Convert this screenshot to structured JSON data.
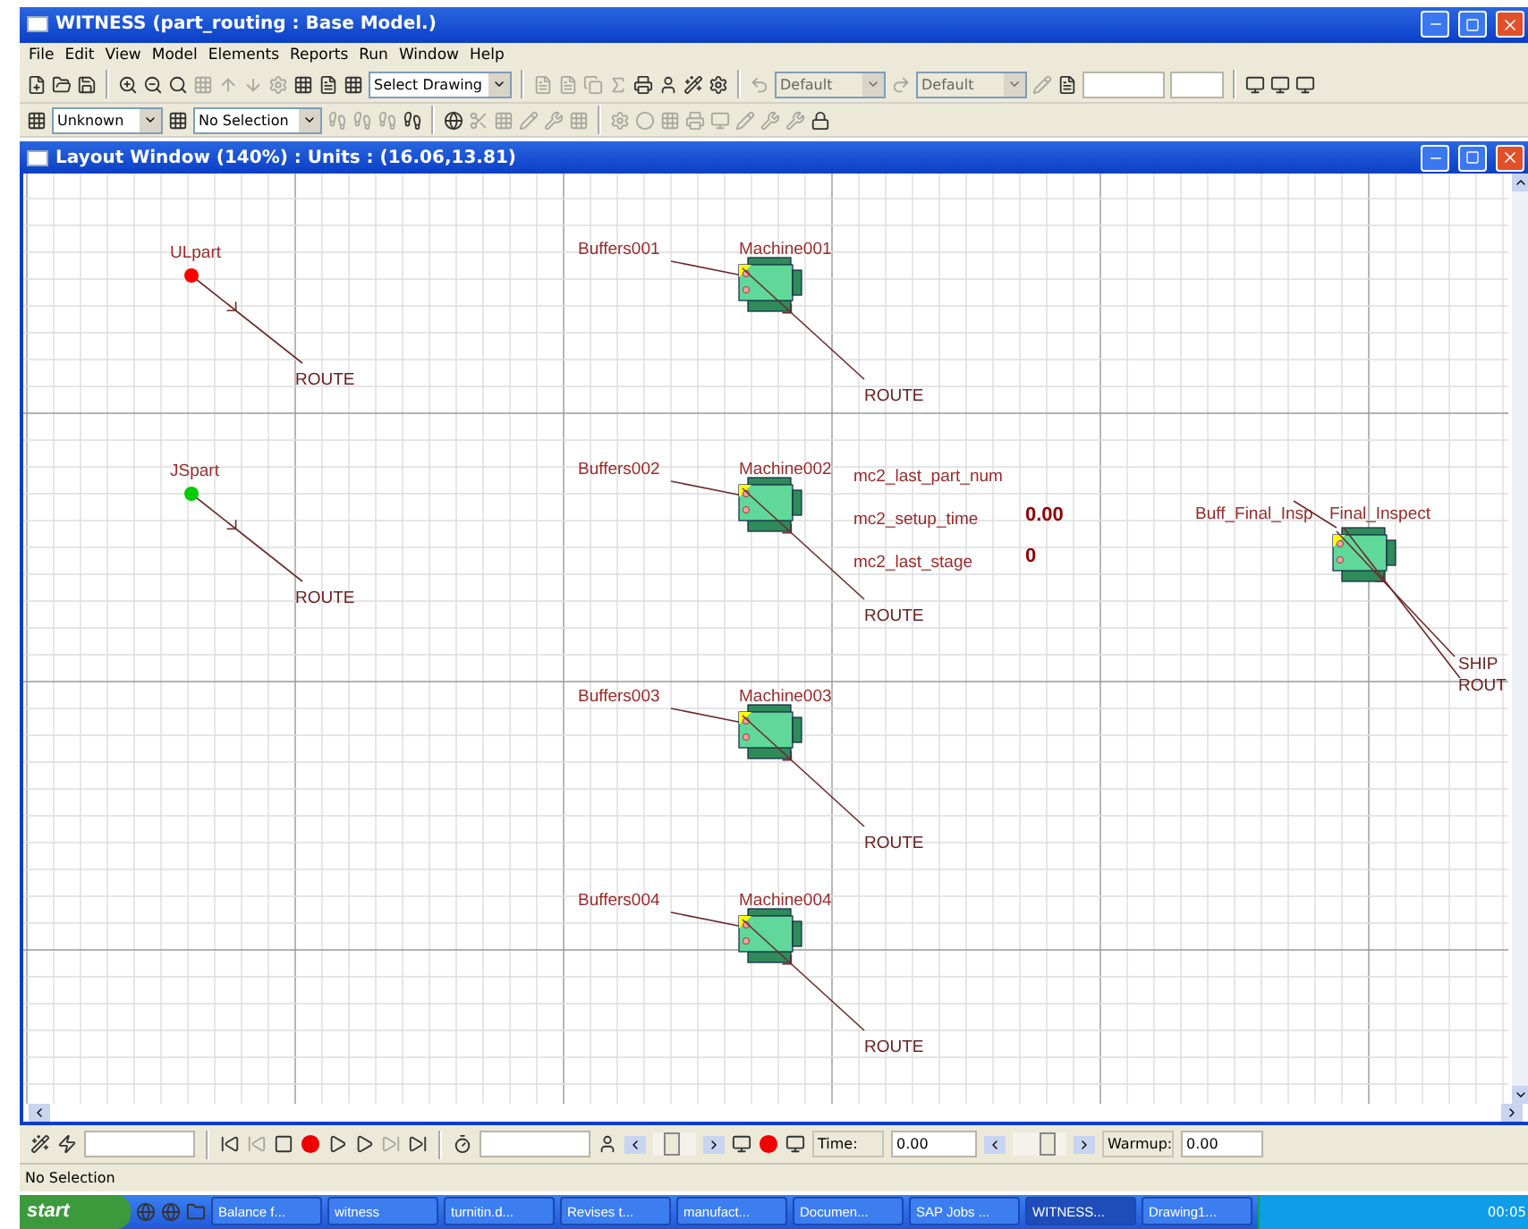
{
  "window": {
    "title": "WITNESS (part_routing : Base Model.)"
  },
  "menu": [
    "File",
    "Edit",
    "View",
    "Model",
    "Elements",
    "Reports",
    "Run",
    "Window",
    "Help"
  ],
  "toolbar": {
    "drawing_select": "Select Drawing",
    "style_selects": [
      {
        "value": "Default",
        "disabled": true
      },
      {
        "value": "Default",
        "disabled": true
      }
    ]
  },
  "element_bar": {
    "type_select": "Unknown",
    "selection_select": "No Selection"
  },
  "layout_window": {
    "title": "Layout Window (140%)  : Units : (16.06,13.81)",
    "parts": [
      {
        "name": "ULpart",
        "color": "#ff0000",
        "route": "ROUTE"
      },
      {
        "name": "JSpart",
        "color": "#00cc00",
        "route": "ROUTE"
      }
    ],
    "lines": [
      {
        "buffer": "Buffers001",
        "machine": "Machine001",
        "route": "ROUTE"
      },
      {
        "buffer": "Buffers002",
        "machine": "Machine002",
        "route": "ROUTE"
      },
      {
        "buffer": "Buffers003",
        "machine": "Machine003",
        "route": "ROUTE"
      },
      {
        "buffer": "Buffers004",
        "machine": "Machine004",
        "route": "ROUTE"
      }
    ],
    "variables": [
      {
        "name": "mc2_last_part_num"
      },
      {
        "name": "mc2_setup_time",
        "value": "0.00"
      },
      {
        "name": "mc2_last_stage",
        "value": "0"
      }
    ],
    "final": {
      "buffer": "Buff_Final_Insp",
      "machine": "Final_Inspect",
      "routes": [
        "SHIP",
        "ROUT"
      ]
    }
  },
  "run_bar": {
    "speed_slider": {
      "level": 0.4
    },
    "time_slider": {
      "level": 0.7
    },
    "time_label": "Time:",
    "time": "0.00",
    "warmup_label": "Warmup:",
    "warmup": "0.00"
  },
  "status_bar": "No Selection",
  "taskbar": {
    "start": "start",
    "tasks": [
      {
        "label": "Balance f...",
        "selected": false
      },
      {
        "label": "witness",
        "selected": false
      },
      {
        "label": "turnitin.d...",
        "selected": false
      },
      {
        "label": "Revises t...",
        "selected": false
      },
      {
        "label": "manufact...",
        "selected": false
      },
      {
        "label": "Documen...",
        "selected": false
      },
      {
        "label": "SAP Jobs ...",
        "selected": false
      },
      {
        "label": "WITNESS...",
        "selected": true
      },
      {
        "label": "Drawing1...",
        "selected": false
      }
    ],
    "clock": "00:05"
  }
}
